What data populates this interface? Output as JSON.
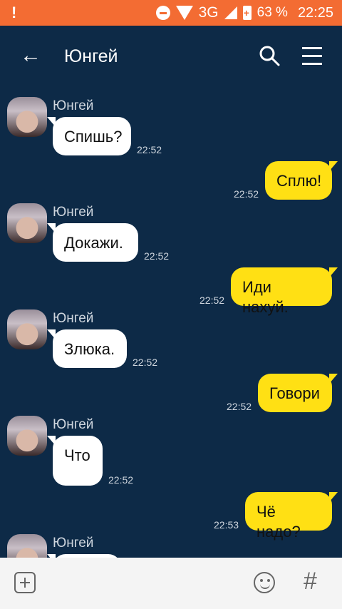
{
  "status_bar": {
    "battery": "63 %",
    "network": "3G",
    "time": "22:25"
  },
  "header": {
    "title": "Юнгей"
  },
  "messages": [
    {
      "side": "in",
      "sender": "Юнгей",
      "text": "Спишь?",
      "time": "22:52"
    },
    {
      "side": "out",
      "text": "Сплю!",
      "time": "22:52"
    },
    {
      "side": "in",
      "sender": "Юнгей",
      "text": "Докажи.",
      "time": "22:52"
    },
    {
      "side": "out",
      "text": "Иди нахуй.",
      "time": "22:52"
    },
    {
      "side": "in",
      "sender": "Юнгей",
      "text": "Злюка.",
      "time": "22:52"
    },
    {
      "side": "out",
      "text": "Говори",
      "time": "22:52"
    },
    {
      "side": "in",
      "sender": "Юнгей",
      "text": "Что",
      "time": "22:52"
    },
    {
      "side": "out",
      "text": "Чё надо?",
      "time": "22:53"
    },
    {
      "side": "in",
      "sender": "Юнгей",
      "text": "",
      "time": ""
    }
  ],
  "icons": {
    "back": "arrow-left-icon",
    "search": "search-icon",
    "menu": "menu-icon",
    "attach": "plus-icon",
    "emoji": "smile-icon",
    "hashtag": "hash-icon"
  },
  "colors": {
    "status_bar": "#f36c33",
    "background": "#0d2a47",
    "outgoing_bubble": "#ffe014",
    "incoming_bubble": "#ffffff"
  }
}
